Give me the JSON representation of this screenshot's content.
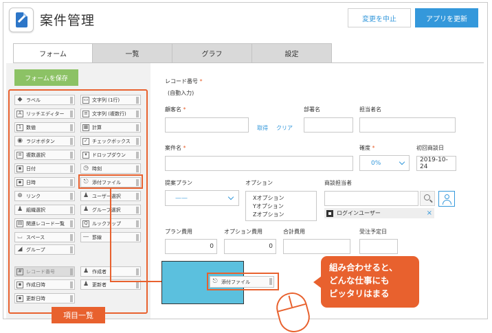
{
  "header": {
    "app_title": "案件管理",
    "cancel_label": "変更を中止",
    "update_label": "アプリを更新"
  },
  "tabs": [
    "フォーム",
    "一覧",
    "グラフ",
    "設定"
  ],
  "palette": {
    "save_label": "フォームを保存",
    "items": [
      {
        "label": "ラベル",
        "icon": "tag-icon"
      },
      {
        "label": "文字列 (1行)",
        "icon": "single-line-text-icon"
      },
      {
        "label": "リッチエディター",
        "icon": "rich-editor-icon"
      },
      {
        "label": "文字列 (複数行)",
        "icon": "multi-line-text-icon"
      },
      {
        "label": "数値",
        "icon": "number-icon"
      },
      {
        "label": "計算",
        "icon": "calculator-icon"
      },
      {
        "label": "ラジオボタン",
        "icon": "radio-button-icon"
      },
      {
        "label": "チェックボックス",
        "icon": "checkbox-icon"
      },
      {
        "label": "複数選択",
        "icon": "multi-select-icon"
      },
      {
        "label": "ドロップダウン",
        "icon": "dropdown-icon"
      },
      {
        "label": "日付",
        "icon": "date-icon"
      },
      {
        "label": "時刻",
        "icon": "clock-icon"
      },
      {
        "label": "日時",
        "icon": "datetime-icon"
      },
      {
        "label": "添付ファイル",
        "icon": "paperclip-icon"
      },
      {
        "label": "リンク",
        "icon": "link-icon"
      },
      {
        "label": "ユーザー選択",
        "icon": "user-icon"
      },
      {
        "label": "組織選択",
        "icon": "organization-icon"
      },
      {
        "label": "グループ選択",
        "icon": "group-icon"
      },
      {
        "label": "関連レコード一覧",
        "icon": "related-records-icon"
      },
      {
        "label": "ルックアップ",
        "icon": "lookup-icon"
      },
      {
        "label": "スペース",
        "icon": "space-icon"
      },
      {
        "label": "罫線",
        "icon": "border-line-icon"
      },
      {
        "label": "グループ",
        "icon": "group-folder-icon"
      },
      {
        "label": "レコード番号",
        "icon": "record-number-icon"
      },
      {
        "label": "作成者",
        "icon": "creator-icon"
      },
      {
        "label": "作成日時",
        "icon": "created-datetime-icon"
      },
      {
        "label": "更新者",
        "icon": "updater-icon"
      },
      {
        "label": "更新日時",
        "icon": "updated-datetime-icon"
      }
    ],
    "callout": "項目一覧"
  },
  "form": {
    "record_number": {
      "label": "レコード番号",
      "value": "(自動入力)"
    },
    "customer": {
      "label": "顧客名",
      "get_link": "取得",
      "clear_link": "クリア"
    },
    "department": {
      "label": "部署名"
    },
    "person_in_charge": {
      "label": "担当者名"
    },
    "case_name": {
      "label": "案件名"
    },
    "certainty": {
      "label": "確度",
      "value": "0%"
    },
    "first_meeting": {
      "label": "初回商談日",
      "value": "2019-10-24"
    },
    "plan": {
      "label": "提案プラン",
      "value": "——"
    },
    "options": {
      "label": "オプション",
      "items": [
        "Xオプション",
        "Yオプション",
        "Zオプション"
      ]
    },
    "sales_rep": {
      "label": "商談担当者",
      "user": "ログインユーザー",
      "remove": "×"
    },
    "plan_cost": {
      "label": "プラン費用",
      "value": "0"
    },
    "option_cost": {
      "label": "オプション費用",
      "value": "0"
    },
    "total_cost": {
      "label": "合計費用"
    },
    "order_date": {
      "label": "受注予定日"
    },
    "dragged_item": "添付ファイル",
    "required_mark": "*"
  },
  "callout_combo": [
    "組み合わせると、",
    "どんな仕事にも",
    "ピッタリはまる"
  ],
  "colors": {
    "accent": "#e8612e",
    "primary": "#3498db",
    "save_green": "#8cc265",
    "drop_area": "#5bc0de"
  }
}
